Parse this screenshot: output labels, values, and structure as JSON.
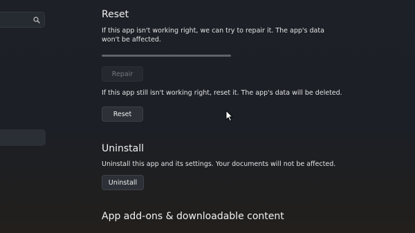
{
  "nav": {
    "search_icon": "search-icon"
  },
  "reset_section": {
    "heading": "Reset",
    "repair_description_line1": "If this app isn't working right, we can try to repair it. The app's data",
    "repair_description_line2": "won't be affected.",
    "repair_progress": 1.0,
    "repair_button_label": "Repair",
    "repair_button_state": "disabled",
    "reset_description": "If this app still isn't working right, reset it. The app's data will be deleted.",
    "reset_button_label": "Reset"
  },
  "uninstall_section": {
    "heading": "Uninstall",
    "description": "Uninstall this app and its settings. Your documents will not be affected.",
    "button_label": "Uninstall"
  },
  "addons_section": {
    "heading": "App add-ons & downloadable content"
  },
  "colors": {
    "background": "#1e2128",
    "button": "#2d3037",
    "text": "#f2f2f2"
  }
}
